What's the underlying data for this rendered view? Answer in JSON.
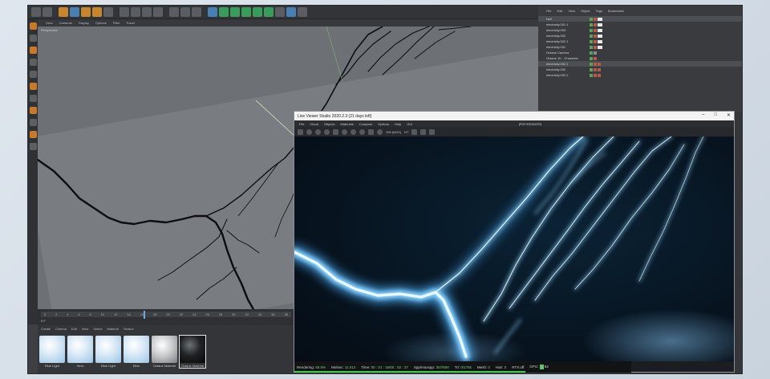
{
  "c4d": {
    "viewport_menu": [
      "View",
      "Cameras",
      "Display",
      "Options",
      "Filter",
      "Panel"
    ],
    "viewport_title": "Perspective",
    "timeline": {
      "ticks": [
        "0",
        "2",
        "4",
        "6",
        "8",
        "10",
        "12",
        "14",
        "16",
        "18",
        "20",
        "22",
        "24",
        "26",
        "28",
        "30",
        "32",
        "34",
        "36",
        "38"
      ],
      "frame_field": "0 F",
      "current_frame_fraction": 0.39
    },
    "material_menu": [
      "Create",
      "Cinema",
      "Edit",
      "View",
      "Select",
      "Material",
      "Texture"
    ],
    "materials": [
      {
        "label": "Blue Light",
        "style": "blue"
      },
      {
        "label": "Hero",
        "style": "blue"
      },
      {
        "label": "Blue Light",
        "style": "blue"
      },
      {
        "label": "Blue",
        "style": "blue"
      },
      {
        "label": "Octane Material",
        "style": "gray"
      },
      {
        "label": "Octane Material",
        "style": "dark",
        "selected": true
      }
    ],
    "object_manager": {
      "menu": [
        "File",
        "Edit",
        "View",
        "Object",
        "Tags",
        "Bookmarks"
      ],
      "objects": [
        {
          "name": "Null",
          "selected": true
        },
        {
          "name": "electricity.001.1"
        },
        {
          "name": "electricity.003"
        },
        {
          "name": "electricity.002"
        },
        {
          "name": "electricity.002.1"
        },
        {
          "name": "electricity.001"
        },
        {
          "name": "Octane Camera"
        },
        {
          "name": "Octane 1K - Character"
        },
        {
          "name": "electricity.002.1"
        },
        {
          "name": "electricity.000"
        },
        {
          "name": "electricity.002.2"
        }
      ]
    }
  },
  "live_viewer": {
    "title": "Live Viewer Studio 2020.2.3 (21 days left)",
    "window_buttons": [
      "–",
      "□",
      "✕"
    ],
    "menu": [
      "File",
      "Cloud",
      "Objects",
      "Materials",
      "Compare",
      "Options",
      "Help",
      "GUI"
    ],
    "menu_right": "[PDF/RENDER]",
    "toolbar_readout": [
      "100 (NOX)",
      "HT"
    ],
    "status": {
      "rendering_label": "Rendering:",
      "rendering_value": "68.5%",
      "mssec_label": "Ms/sec:",
      "mssec_value": "11.012",
      "time_label": "Time:",
      "time_value": "00 : 01 : 15/00 : 02 : 37",
      "spp_label": "Spp/maxspp:",
      "spp_value": "357/600",
      "tri_label": "Tri:",
      "tri_value": "0/175k",
      "mesh_label": "Mesh:",
      "mesh_value": "0",
      "hair_label": "Hair:",
      "hair_value": "0",
      "rtx_label": "RTX:off",
      "gpu_label": "GPU:",
      "gpu_value": "82"
    },
    "progress_fraction": 0.685
  },
  "colors": {
    "lightning": "#6fc6ff",
    "lightning_core": "#e8f8ff",
    "progress": "#41c84c"
  }
}
